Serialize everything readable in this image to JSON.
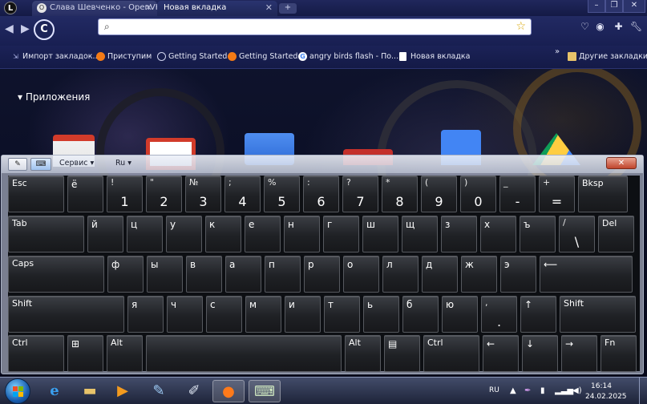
{
  "browser": {
    "logo": "L",
    "tabs": [
      {
        "title": "Слава Шевченко - OpenVK",
        "active": false
      },
      {
        "title": "Новая вкладка",
        "active": true
      }
    ],
    "address_value": "",
    "bookmarks": [
      {
        "label": "Импорт закладок...",
        "icon": "import-icon"
      },
      {
        "label": "Приступим",
        "icon": "firefox-icon"
      },
      {
        "label": "Getting Started",
        "icon": "globe-icon"
      },
      {
        "label": "Getting Started",
        "icon": "firefox-icon"
      },
      {
        "label": "angry birds flash - По...",
        "icon": "google-icon"
      },
      {
        "label": "Новая вкладка",
        "icon": "page-icon"
      }
    ],
    "other_bookmarks": "Другие закладки"
  },
  "newtab": {
    "apps_header": "Приложения"
  },
  "osk": {
    "menu_service": "Сервис",
    "menu_lang": "Ru",
    "rows": [
      [
        {
          "u": "Esc",
          "l": ""
        },
        {
          "u": "ё",
          "l": ""
        },
        {
          "u": "!",
          "l": "1"
        },
        {
          "u": "\"",
          "l": "2"
        },
        {
          "u": "№",
          "l": "3"
        },
        {
          "u": ";",
          "l": "4"
        },
        {
          "u": "%",
          "l": "5"
        },
        {
          "u": ":",
          "l": "6"
        },
        {
          "u": "?",
          "l": "7"
        },
        {
          "u": "*",
          "l": "8"
        },
        {
          "u": "(",
          "l": "9"
        },
        {
          "u": ")",
          "l": "0"
        },
        {
          "u": "_",
          "l": "-"
        },
        {
          "u": "+",
          "l": "="
        },
        {
          "u": "Bksp",
          "l": ""
        }
      ],
      [
        {
          "u": "Tab",
          "l": ""
        },
        {
          "u": "й",
          "l": ""
        },
        {
          "u": "ц",
          "l": ""
        },
        {
          "u": "у",
          "l": ""
        },
        {
          "u": "к",
          "l": ""
        },
        {
          "u": "е",
          "l": ""
        },
        {
          "u": "н",
          "l": ""
        },
        {
          "u": "г",
          "l": ""
        },
        {
          "u": "ш",
          "l": ""
        },
        {
          "u": "щ",
          "l": ""
        },
        {
          "u": "з",
          "l": ""
        },
        {
          "u": "х",
          "l": ""
        },
        {
          "u": "ъ",
          "l": ""
        },
        {
          "u": "/",
          "l": "\\"
        },
        {
          "u": "Del",
          "l": ""
        }
      ],
      [
        {
          "u": "Caps",
          "l": ""
        },
        {
          "u": "ф",
          "l": ""
        },
        {
          "u": "ы",
          "l": ""
        },
        {
          "u": "в",
          "l": ""
        },
        {
          "u": "а",
          "l": ""
        },
        {
          "u": "п",
          "l": ""
        },
        {
          "u": "р",
          "l": ""
        },
        {
          "u": "о",
          "l": ""
        },
        {
          "u": "л",
          "l": ""
        },
        {
          "u": "д",
          "l": ""
        },
        {
          "u": "ж",
          "l": ""
        },
        {
          "u": "э",
          "l": ""
        },
        {
          "u": "⟵",
          "l": ""
        }
      ],
      [
        {
          "u": "Shift",
          "l": ""
        },
        {
          "u": "я",
          "l": ""
        },
        {
          "u": "ч",
          "l": ""
        },
        {
          "u": "с",
          "l": ""
        },
        {
          "u": "м",
          "l": ""
        },
        {
          "u": "и",
          "l": ""
        },
        {
          "u": "т",
          "l": ""
        },
        {
          "u": "ь",
          "l": ""
        },
        {
          "u": "б",
          "l": ""
        },
        {
          "u": "ю",
          "l": ""
        },
        {
          "u": ",",
          "l": "."
        },
        {
          "u": "↑",
          "l": ""
        },
        {
          "u": "Shift",
          "l": ""
        }
      ],
      [
        {
          "u": "Ctrl",
          "l": ""
        },
        {
          "u": "⊞",
          "l": ""
        },
        {
          "u": "Alt",
          "l": ""
        },
        {
          "u": "",
          "l": ""
        },
        {
          "u": "Alt",
          "l": ""
        },
        {
          "u": "▤",
          "l": ""
        },
        {
          "u": "Ctrl",
          "l": ""
        },
        {
          "u": "←",
          "l": ""
        },
        {
          "u": "↓",
          "l": ""
        },
        {
          "u": "→",
          "l": ""
        },
        {
          "u": "Fn",
          "l": ""
        }
      ]
    ]
  },
  "taskbar": {
    "language": "RU",
    "time": "16:14",
    "date": "24.02.2025"
  }
}
